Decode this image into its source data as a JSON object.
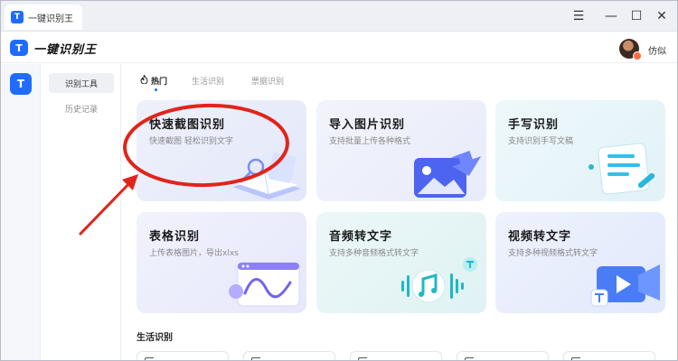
{
  "window": {
    "tab_title": "一键识别王",
    "tab_icon_letter": "T",
    "controls": {
      "menu": "☰",
      "minimize": "—",
      "maximize": "☐",
      "close": "✕"
    }
  },
  "header": {
    "app_name": "一键识别王",
    "logo_letter": "T",
    "username": "仿似"
  },
  "rail": {
    "icon_letter": "T"
  },
  "nav": {
    "items": [
      {
        "label": "识别工具",
        "active": true
      },
      {
        "label": "历史记录",
        "active": false
      }
    ]
  },
  "tabs": [
    {
      "label": "热门",
      "icon": "fire-icon",
      "active": true
    },
    {
      "label": "生活识别",
      "active": false
    },
    {
      "label": "票据识别",
      "active": false
    }
  ],
  "cards": [
    {
      "title": "快速截图识别",
      "subtitle": "快速截图 轻松识别文字"
    },
    {
      "title": "导入图片识别",
      "subtitle": "支持批量上传各种格式"
    },
    {
      "title": "手写识别",
      "subtitle": "支持识别手写文稿"
    },
    {
      "title": "表格识别",
      "subtitle": "上传表格图片，导出xlxs"
    },
    {
      "title": "音频转文字",
      "subtitle": "支持多种音频格式转文字"
    },
    {
      "title": "视频转文字",
      "subtitle": "支持多种视频格式转文字"
    }
  ],
  "section": {
    "title": "生活识别"
  },
  "colors": {
    "accent": "#1f6cff",
    "annotation": "#e1241b"
  }
}
